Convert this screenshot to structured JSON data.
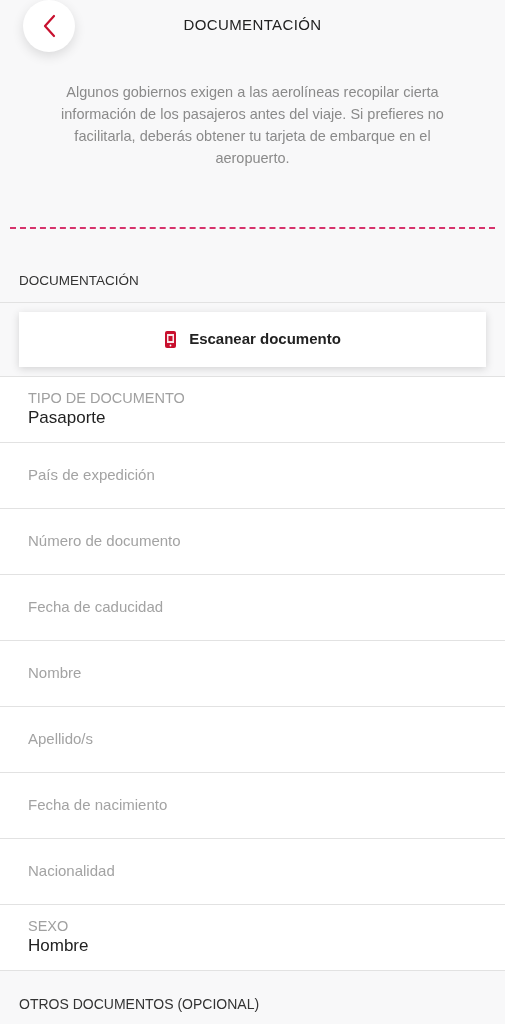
{
  "header": {
    "title": "DOCUMENTACIÓN"
  },
  "intro": "Algunos gobiernos exigen a las aerolíneas recopilar cierta información de los pasajeros antes del viaje. Si prefieres no facilitarla, deberás obtener tu tarjeta de embarque en el aeropuerto.",
  "section": {
    "title": "DOCUMENTACIÓN"
  },
  "scan_button": "Escanear documento",
  "fields": [
    {
      "kind": "filled",
      "label": "TIPO DE DOCUMENTO",
      "value": "Pasaporte"
    },
    {
      "kind": "empty",
      "placeholder": "País de expedición"
    },
    {
      "kind": "empty",
      "placeholder": "Número de documento"
    },
    {
      "kind": "empty",
      "placeholder": "Fecha de caducidad"
    },
    {
      "kind": "empty",
      "placeholder": "Nombre"
    },
    {
      "kind": "empty",
      "placeholder": "Apellido/s"
    },
    {
      "kind": "empty",
      "placeholder": "Fecha de nacimiento"
    },
    {
      "kind": "empty",
      "placeholder": "Nacionalidad"
    },
    {
      "kind": "filled",
      "label": "SEXO",
      "value": "Hombre"
    }
  ],
  "other_section": {
    "title": "OTROS DOCUMENTOS (OPCIONAL)"
  }
}
